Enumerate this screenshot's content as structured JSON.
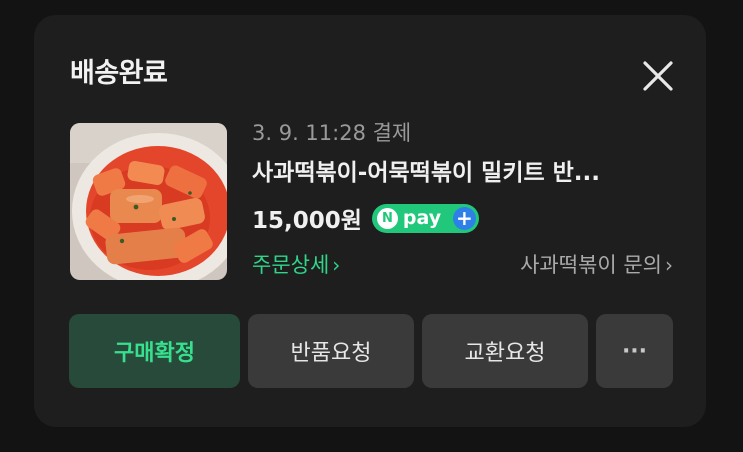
{
  "order_card": {
    "status_title": "배송완료",
    "icons": {
      "close": "close-icon",
      "chevron": "chevron-right-icon",
      "more": "more-horizontal-icon",
      "npay": "npay-plus-badge"
    },
    "product": {
      "paid_at": "3. 9. 11:28 결제",
      "name": "사과떡볶이-어묵떡볶이 밀키트 반...",
      "price": "15,000원",
      "payment_badge": {
        "n_letter": "N",
        "label": "pay",
        "plus": "+"
      }
    },
    "links": {
      "order_detail": "주문상세",
      "seller_inquiry": "사과떡볶이 문의",
      "chevron_glyph": "›"
    },
    "actions": {
      "confirm_purchase": "구매확정",
      "return_request": "반품요청",
      "exchange_request": "교환요청",
      "more": "···"
    },
    "colors": {
      "background": "#131313",
      "card": "#1e1e1e",
      "accent_green": "#2fd68a",
      "confirm_button_bg": "#284a3a",
      "secondary_button_bg": "#3a3a3a",
      "npay_green": "#21c77a",
      "npay_plus_blue": "#2f7fe8"
    }
  }
}
